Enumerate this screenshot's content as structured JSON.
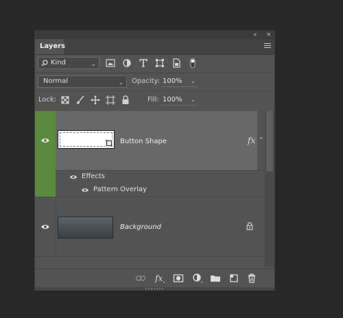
{
  "panel": {
    "title_controls": {
      "collapse": "«",
      "close": "×"
    },
    "tab_label": "Layers"
  },
  "filter": {
    "kind_label": "Kind",
    "icons": [
      "image-filter-icon",
      "adjustment-filter-icon",
      "type-filter-icon",
      "shape-filter-icon",
      "smart-object-filter-icon",
      "filter-toggle-icon"
    ]
  },
  "blend": {
    "mode": "Normal",
    "opacity_label": "Opacity:",
    "opacity_value": "100%"
  },
  "lock": {
    "label": "Lock:",
    "icons": [
      "lock-transparent-icon",
      "lock-image-icon",
      "lock-position-icon",
      "lock-artboard-icon",
      "lock-all-icon"
    ],
    "fill_label": "Fill:",
    "fill_value": "100%"
  },
  "layers": [
    {
      "name": "Button Shape",
      "fx_label": "fx",
      "effects_label": "Effects",
      "effects": [
        "Pattern Overlay"
      ]
    },
    {
      "name": "Background"
    }
  ],
  "bottom_icons": [
    "link-layers-icon",
    "add-style-icon",
    "add-mask-icon",
    "adjustment-layer-icon",
    "new-group-icon",
    "new-layer-icon",
    "delete-layer-icon"
  ],
  "colors": {
    "selected_eye_bg": "#5b8a3d",
    "selected_row_bg": "#686868",
    "panel_bg": "#535353"
  }
}
